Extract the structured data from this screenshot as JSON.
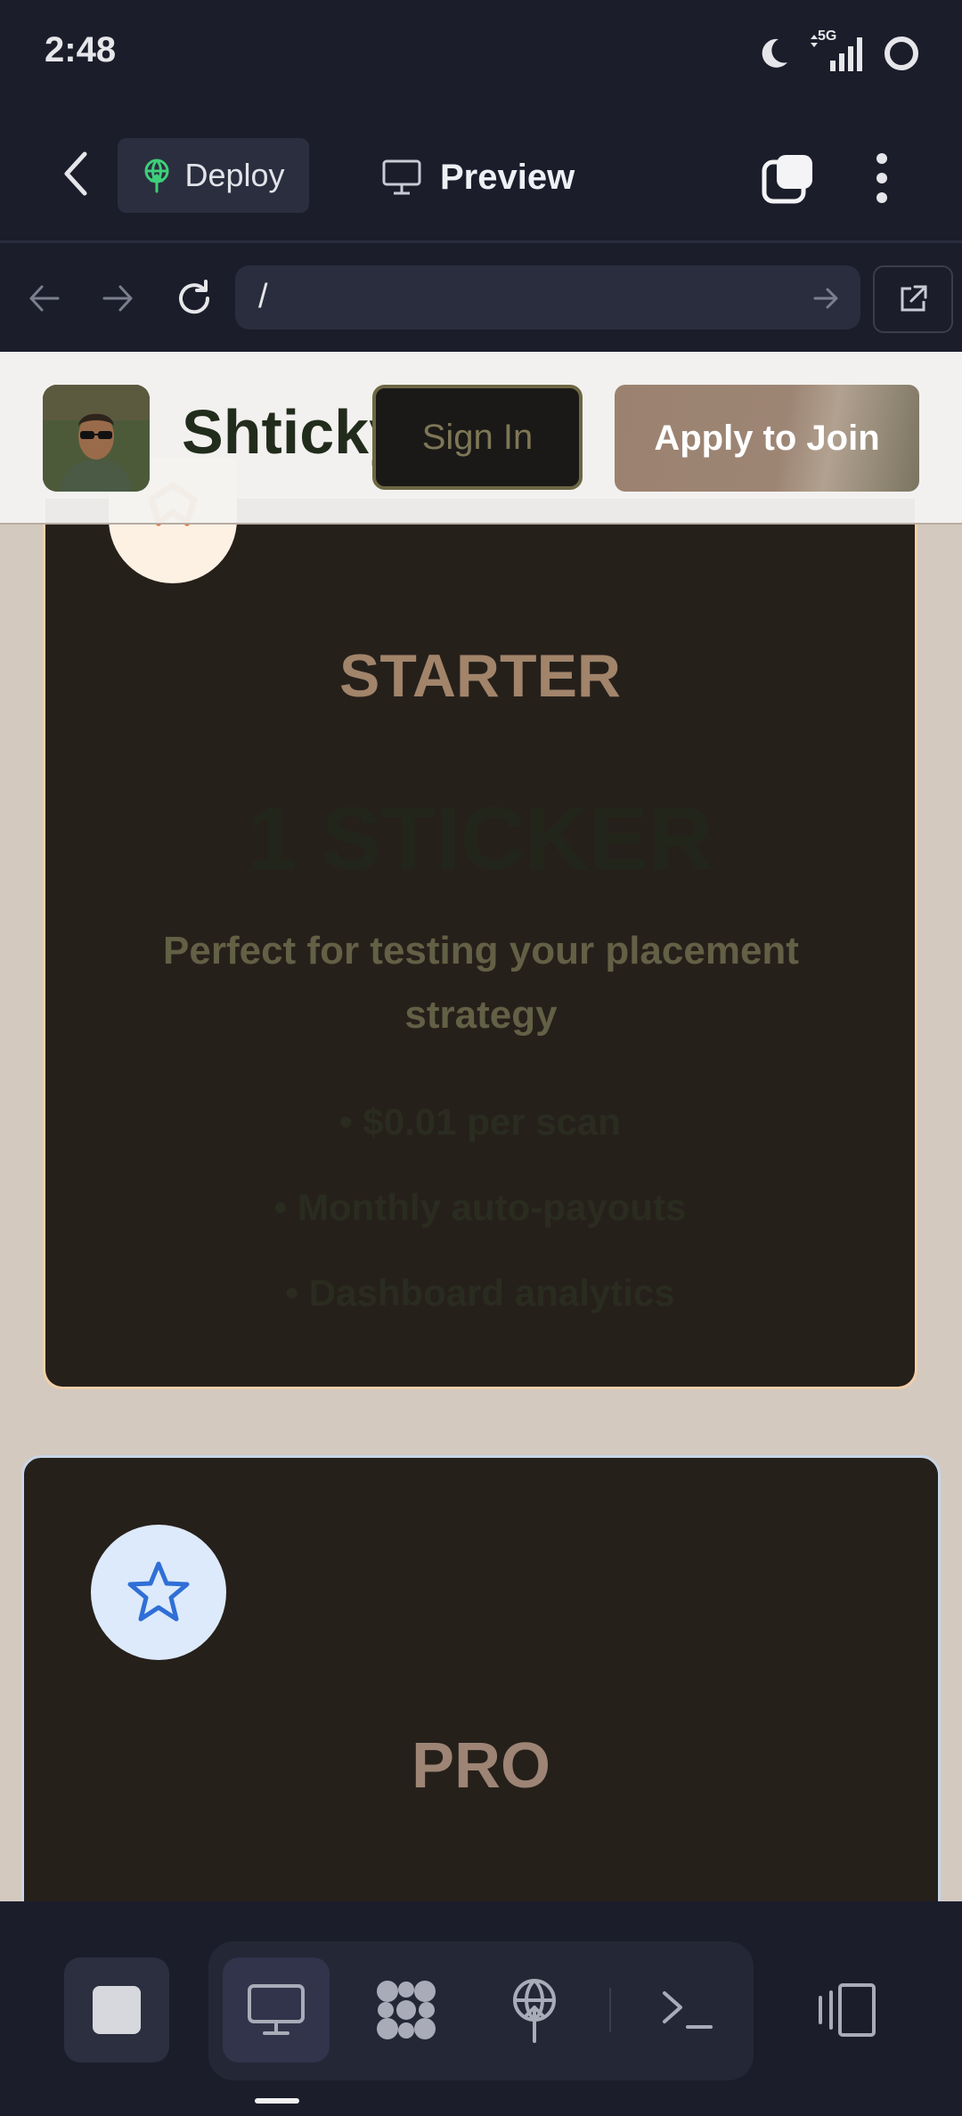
{
  "status_bar": {
    "time": "2:48",
    "network": "5G"
  },
  "toolbar": {
    "deploy_label": "Deploy",
    "preview_label": "Preview"
  },
  "url_bar": {
    "url": "/"
  },
  "site": {
    "brand": "Shticky",
    "sign_in": "Sign In",
    "apply": "Apply to Join"
  },
  "plans": [
    {
      "title": "STARTER",
      "price": "1 STICKER",
      "description": "Perfect for testing your placement strategy",
      "features": [
        "• $0.01 per scan",
        "• Monthly auto-payouts",
        "• Dashboard analytics"
      ],
      "icon": "star-icon",
      "accent": "#e2621f"
    },
    {
      "title": "PRO",
      "icon": "star-icon",
      "accent": "#2f6fd6"
    }
  ],
  "bottom_bar": {
    "icons": [
      "stop-icon",
      "desktop-icon",
      "extensions-icon",
      "deploy-icon",
      "terminal-icon",
      "layout-icon"
    ]
  }
}
